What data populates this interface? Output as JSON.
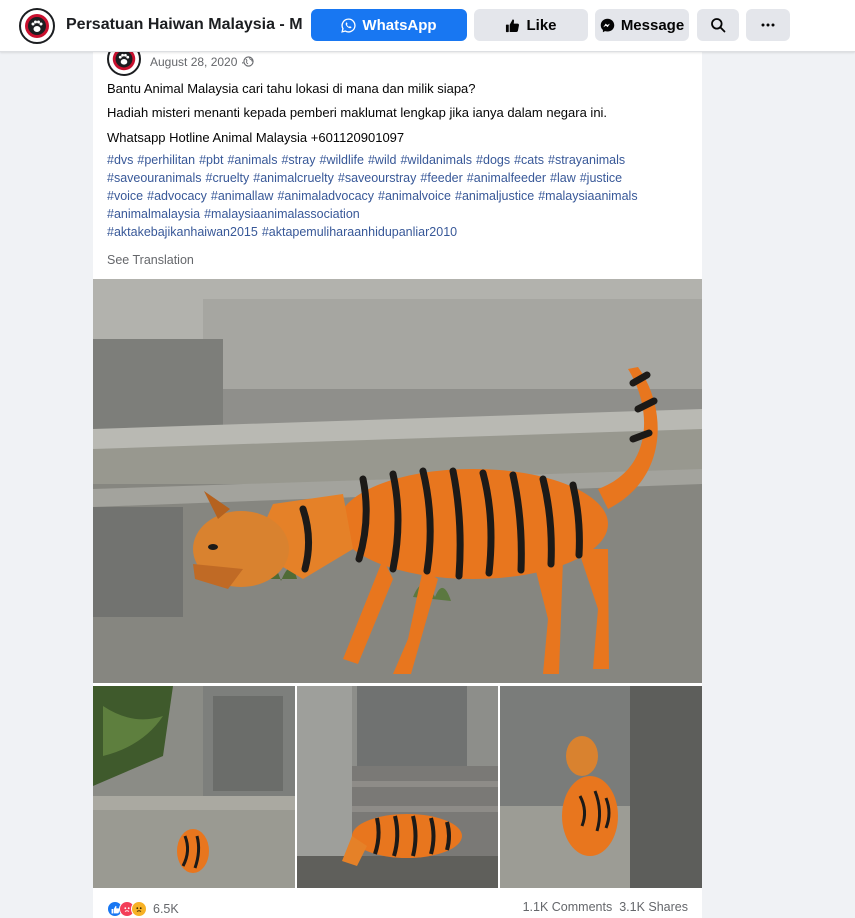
{
  "header": {
    "page_name": "Persatuan Haiwan Malaysia - Ma...",
    "whatsapp_label": "WhatsApp",
    "like_label": "Like",
    "message_label": "Message",
    "search_icon": "search-icon",
    "more_icon": "more-icon"
  },
  "post": {
    "date": "August 28, 2020 ·",
    "privacy_icon": "globe-icon",
    "more_label": "···",
    "lines": [
      "Bantu Animal Malaysia cari tahu lokasi di mana dan milik siapa?",
      "Hadiah misteri menanti kepada pemberi maklumat lengkap jika ianya dalam negara ini.",
      "Whatsapp Hotline Animal Malaysia +601120901097"
    ],
    "hashtags": [
      "#dvs",
      "#perhilitan",
      "#pbt",
      "#animals",
      "#stray",
      "#wildlife",
      "#wild",
      "#wildanimals",
      "#dogs",
      "#cats",
      "#strayanimals",
      "#saveouranimals",
      "#cruelty",
      "#animalcruelty",
      "#saveourstray",
      "#feeder",
      "#animalfeeder",
      "#law",
      "#justice",
      "#voice",
      "#advocacy",
      "#animallaw",
      "#animaladvocacy",
      "#animalvoice",
      "#animaljustice",
      "#malaysiaanimals",
      "#animalmalaysia",
      "#malaysiaanimalassociation",
      "#aktakebajikanhaiwan2015",
      "#aktapemuliharaanhidupanliar2010"
    ],
    "see_translation": "See Translation",
    "reaction_count": "6.5K",
    "comments": "1.1K Comments",
    "shares": "3.1K Shares"
  },
  "colors": {
    "accent": "#1877f2",
    "hashtag": "#385898",
    "muted": "#65676b",
    "tiger_orange": "#e8761e"
  }
}
